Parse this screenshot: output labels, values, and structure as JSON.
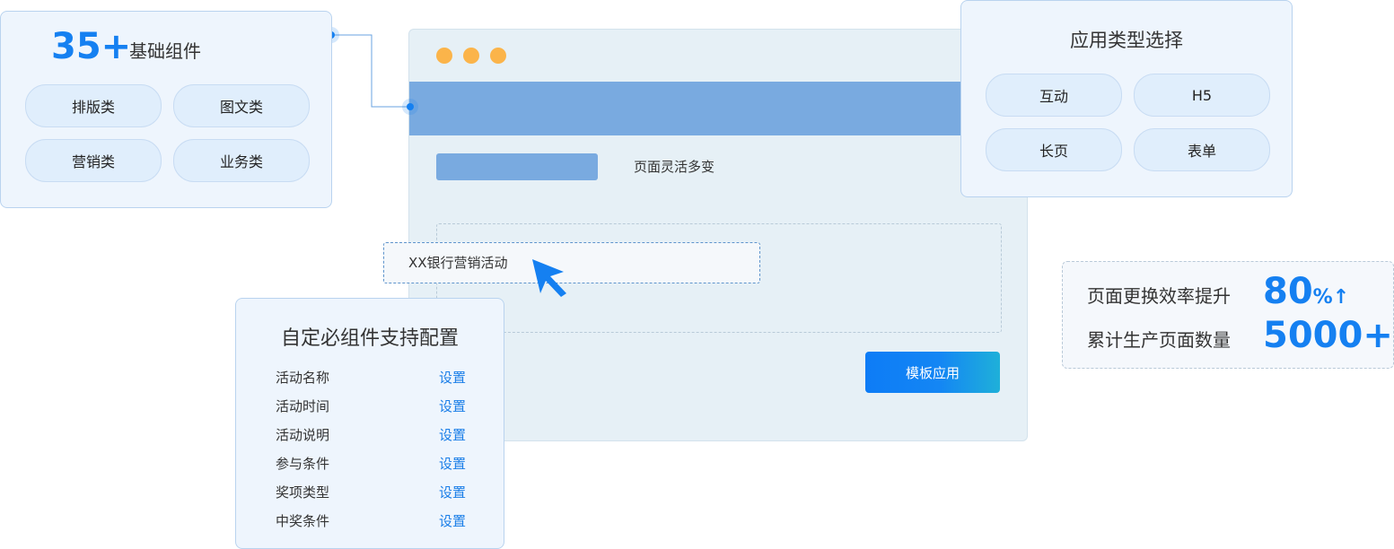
{
  "components_card": {
    "count": "35+",
    "label": "基础组件",
    "categories": [
      "排版类",
      "图文类",
      "营销类",
      "业务类"
    ]
  },
  "type_card": {
    "title": "应用类型选择",
    "options": [
      "互动",
      "H5",
      "长页",
      "表单"
    ]
  },
  "window": {
    "flex_text": "页面灵活多变",
    "activity_input": "XX银行营销活动",
    "apply_button": "模板应用"
  },
  "config_card": {
    "title": "自定必组件支持配置",
    "rows": [
      {
        "label": "活动名称",
        "action": "设置"
      },
      {
        "label": "活动时间",
        "action": "设置"
      },
      {
        "label": "活动说明",
        "action": "设置"
      },
      {
        "label": "参与条件",
        "action": "设置"
      },
      {
        "label": "奖项类型",
        "action": "设置"
      },
      {
        "label": "中奖条件",
        "action": "设置"
      }
    ]
  },
  "stats_card": {
    "efficiency_label": "页面更换效率提升",
    "efficiency_value": "80",
    "efficiency_suffix": "%↑",
    "pages_label": "累计生产页面数量",
    "pages_value": "5000+"
  },
  "colors": {
    "accent": "#1580f1",
    "window_bg": "#e6f0f6",
    "bar": "#79aae0",
    "dot": "#fbb44a",
    "card_bg": "#eef5fd",
    "link": "#1a7ee8"
  },
  "icons": [
    "window-dot-icon",
    "pointer-cursor-icon",
    "connector-node-icon"
  ]
}
